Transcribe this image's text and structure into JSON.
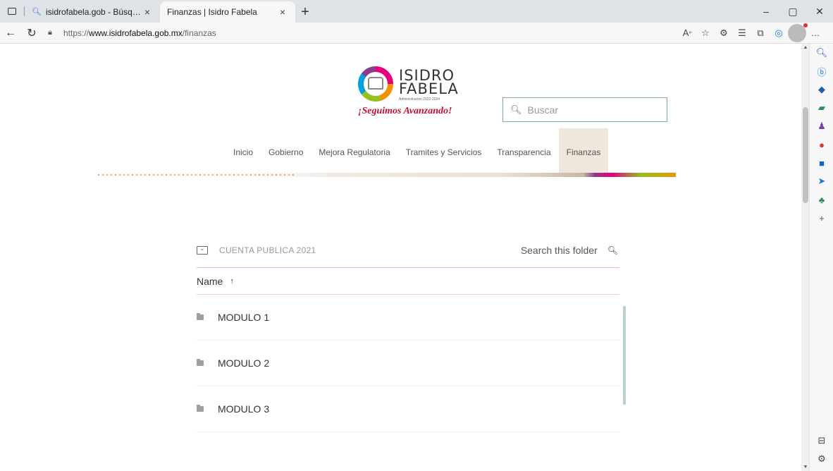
{
  "browser": {
    "tabs": [
      {
        "title": "isidrofabela.gob - Búsqueda",
        "active": false
      },
      {
        "title": "Finanzas | Isidro Fabela",
        "active": true
      }
    ],
    "url_scheme": "https://",
    "url_host": "www.isidrofabela.gob.mx",
    "url_path": "/finanzas"
  },
  "site": {
    "logo_name_line1": "ISIDRO",
    "logo_name_line2": "FABELA",
    "logo_admin": "Administración 2022-2024",
    "logo_slogan": "¡Seguimos Avanzando!",
    "search_placeholder": "Buscar",
    "nav": [
      {
        "label": "Inicio"
      },
      {
        "label": "Gobierno"
      },
      {
        "label": "Mejora Regulatoria"
      },
      {
        "label": "Tramites y Servicios"
      },
      {
        "label": "Transparencia"
      },
      {
        "label": "Finanzas",
        "active": true
      }
    ]
  },
  "folder": {
    "name": "CUENTA PUBLICA 2021",
    "search_label": "Search this folder",
    "column_name": "Name",
    "sort_arrow": "↑",
    "items": [
      {
        "label": "MODULO 1"
      },
      {
        "label": "MODULO 2"
      },
      {
        "label": "MODULO 3"
      }
    ]
  },
  "colors": {
    "active_nav_bg": "#efe6dc",
    "search_border": "#7fa9b0",
    "slogan": "#c8102e",
    "folder_divider": "#f2b8c2"
  }
}
